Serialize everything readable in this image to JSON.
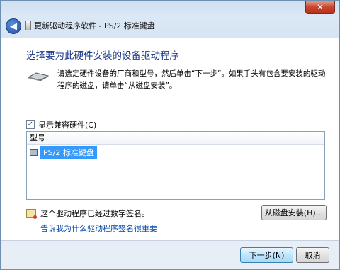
{
  "window": {
    "title": "更新驱动程序软件 - PS/2 标准键盘",
    "close_label": "✕",
    "back_label": "◀"
  },
  "main": {
    "heading": "选择要为此硬件安装的设备驱动程序",
    "description": "请选定硬件设备的厂商和型号，然后单击“下一步”。如果手头有包含要安装的驱动程序的磁盘，请单击“从磁盘安装”。",
    "show_compatible": {
      "label": "显示兼容硬件(C)",
      "checked": true,
      "mark": "✓"
    },
    "model_list": {
      "header": "型号",
      "items": [
        {
          "label": "PS/2 标准键盘",
          "selected": true
        }
      ]
    },
    "signature_text": "这个驱动程序已经过数字签名。",
    "have_disk_label": "从磁盘安装(H)...",
    "why_link": "告诉我为什么驱动程序签名很重要"
  },
  "footer": {
    "next_label": "下一步(N)",
    "cancel_label": "取消"
  },
  "icons": {
    "back": "back-arrow-icon",
    "keyboard": "keyboard-icon",
    "certificate": "certificate-icon",
    "device": "device-icon"
  },
  "colors": {
    "heading": "#1e3a8a",
    "selection": "#3399ff",
    "link": "#0047ab",
    "close": "#c8452d"
  }
}
